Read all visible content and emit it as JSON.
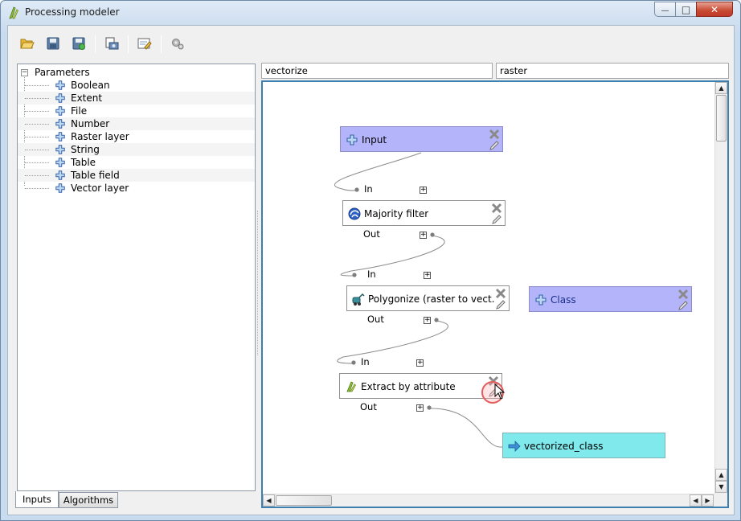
{
  "window": {
    "title": "Processing modeler",
    "minimize_glyph": "—",
    "maximize_glyph": "□",
    "close_glyph": "✕"
  },
  "toolbar": {
    "buttons": [
      {
        "name": "open-model",
        "icon": "folder-open-icon"
      },
      {
        "name": "save-model",
        "icon": "save-icon"
      },
      {
        "name": "save-as-model",
        "icon": "save-as-icon"
      },
      {
        "name": "export-image",
        "icon": "export-image-icon"
      },
      {
        "name": "edit-help",
        "icon": "edit-help-icon"
      },
      {
        "name": "run-model",
        "icon": "run-gears-icon"
      }
    ]
  },
  "inputs_tree": {
    "root_label": "Parameters",
    "expander": "−",
    "items": [
      "Boolean",
      "Extent",
      "File",
      "Number",
      "Raster layer",
      "String",
      "Table",
      "Table field",
      "Vector layer"
    ]
  },
  "tabs": {
    "inputs": "Inputs",
    "algorithms": "Algorithms"
  },
  "model": {
    "name": "vectorize",
    "group": "raster"
  },
  "canvas": {
    "nodes": {
      "input": "Input",
      "majority_filter": "Majority filter",
      "polygonize": "Polygonize (raster to vect...",
      "class_param": "Class",
      "extract": "Extract by attribute",
      "output": "vectorized_class"
    },
    "ports": {
      "in": "In",
      "out": "Out",
      "plus": "+"
    },
    "colors": {
      "parameter": "#b4b4fa",
      "output": "#7fe9ec",
      "focus_border": "#3c7fb1"
    }
  }
}
